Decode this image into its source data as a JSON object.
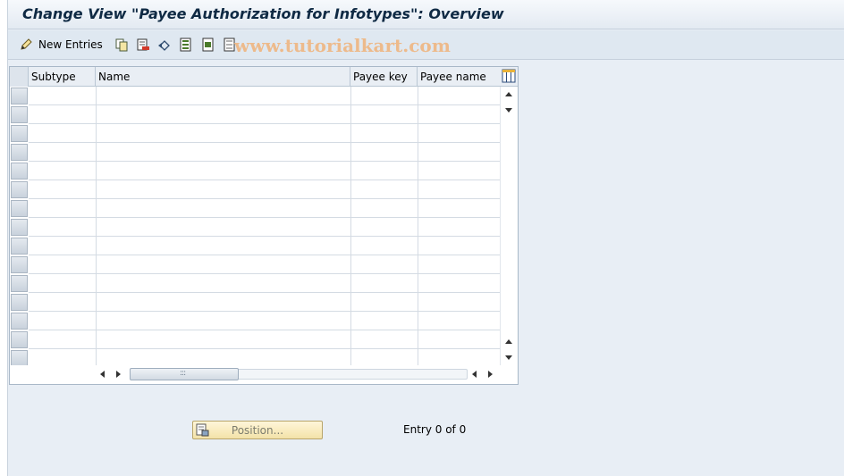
{
  "window": {
    "title": "Change View \"Payee Authorization for Infotypes\": Overview"
  },
  "toolbar": {
    "new_entries_label": "New Entries",
    "icons": [
      "edit-pencil-icon",
      "copy-icon",
      "delete-icon",
      "undo-icon",
      "select-all-icon",
      "select-block-icon",
      "deselect-all-icon"
    ]
  },
  "watermark": "www.tutorialkart.com",
  "table": {
    "columns": [
      "Subtype",
      "Name",
      "Payee key",
      "Payee name"
    ],
    "visible_rows": 15,
    "rows": []
  },
  "footer": {
    "position_button_label": "Position...",
    "entry_count": "Entry 0 of 0"
  },
  "colors": {
    "title_text": "#0f2a44",
    "background": "#e8eef5",
    "position_button": "#f3e2a8",
    "watermark": "#f0b27a"
  }
}
